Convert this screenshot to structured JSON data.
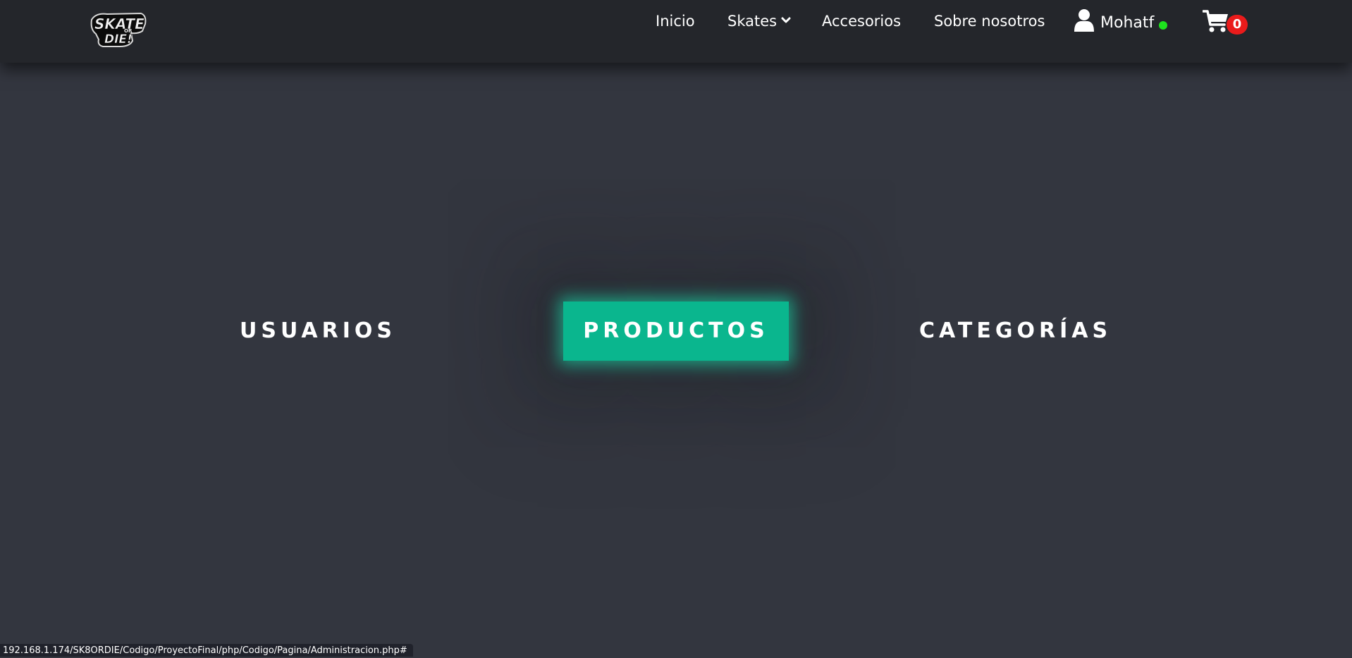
{
  "header": {
    "logo_text": "SKATE OR DIE!",
    "nav": {
      "inicio": "Inicio",
      "skates": "Skates",
      "accesorios": "Accesorios",
      "sobre_nosotros": "Sobre nosotros"
    },
    "user": {
      "name": "Mohatf",
      "status": "online",
      "status_color": "#1ee31e"
    },
    "cart": {
      "count": "0",
      "badge_color": "#ea1b1b"
    }
  },
  "admin_menu": {
    "items": [
      {
        "label": "USUARIOS",
        "active": false
      },
      {
        "label": "PRODUCTOS",
        "active": true
      },
      {
        "label": "CATEGORÍAS",
        "active": false
      }
    ],
    "active_color": "#0ab68e"
  },
  "status_bar": {
    "url": "192.168.1.174/SK8ORDIE/Codigo/ProyectoFinal/php/Codigo/Pagina/Administracion.php#"
  }
}
